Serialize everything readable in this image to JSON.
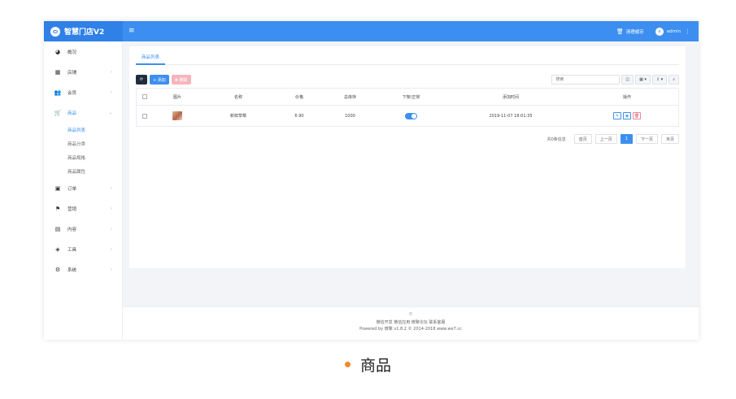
{
  "topbar": {
    "brand": "智慧门店V2",
    "menu_icon": "menu-icon",
    "clear_cache": "清理缓存",
    "user": "admin",
    "avatar_initial": "a"
  },
  "sidebar": {
    "items": [
      {
        "label": "概况",
        "icon": "dashboard-icon",
        "glyph": "◕",
        "chevron": ""
      },
      {
        "label": "店铺",
        "icon": "grid-icon",
        "glyph": "▦",
        "chevron": "›"
      },
      {
        "label": "会员",
        "icon": "users-icon",
        "glyph": "👥",
        "chevron": "›"
      },
      {
        "label": "商品",
        "icon": "cart-icon",
        "glyph": "🛒",
        "chevron": "⌄"
      },
      {
        "label": "订单",
        "icon": "order-icon",
        "glyph": "▣",
        "chevron": "›"
      },
      {
        "label": "营销",
        "icon": "flag-icon",
        "glyph": "⚑",
        "chevron": "›"
      },
      {
        "label": "内容",
        "icon": "file-icon",
        "glyph": "▤",
        "chevron": "›"
      },
      {
        "label": "工具",
        "icon": "cube-icon",
        "glyph": "◈",
        "chevron": "›"
      },
      {
        "label": "系统",
        "icon": "gear-icon",
        "glyph": "⚙",
        "chevron": "›"
      }
    ],
    "subitems": [
      "商品列表",
      "商品分类",
      "商品规格",
      "商品属性"
    ]
  },
  "tabs": [
    "商品列表"
  ],
  "toolbar": {
    "refresh_icon": "refresh-icon",
    "add_label": "+ 添加",
    "delete_label": "✖ 删除"
  },
  "search": {
    "placeholder": "搜索",
    "buttons": [
      "◫",
      "▦ ▾",
      "⇩ ▾",
      "⌕"
    ]
  },
  "table": {
    "headers": [
      "",
      "图片",
      "名称",
      "价格",
      "总库存",
      "下架/正常",
      "添加时间",
      "操作"
    ],
    "rows": [
      {
        "name": "新鲜草莓",
        "price": "6.90",
        "stock": "1000",
        "status_on": true,
        "added": "2019-11-07 18:01:35"
      }
    ]
  },
  "pager": {
    "info": "共0条信息",
    "first": "首页",
    "prev": "上一页",
    "current": "1",
    "next": "下一页",
    "last": "末页"
  },
  "footer": {
    "line0": "©",
    "line1": "微信开发 微信应用 微擎论坛 联系客服",
    "line2": "Powered by 微擎 v1.8.2 © 2014-2018 www.we7.cc"
  },
  "caption": "商品",
  "colors": {
    "primary": "#3c8ff0",
    "brand_bg": "#2f80e7",
    "dark_btn": "#1f2d3d",
    "delete_btn": "#f7b4bd",
    "caption_dot": "#f08a2a"
  }
}
